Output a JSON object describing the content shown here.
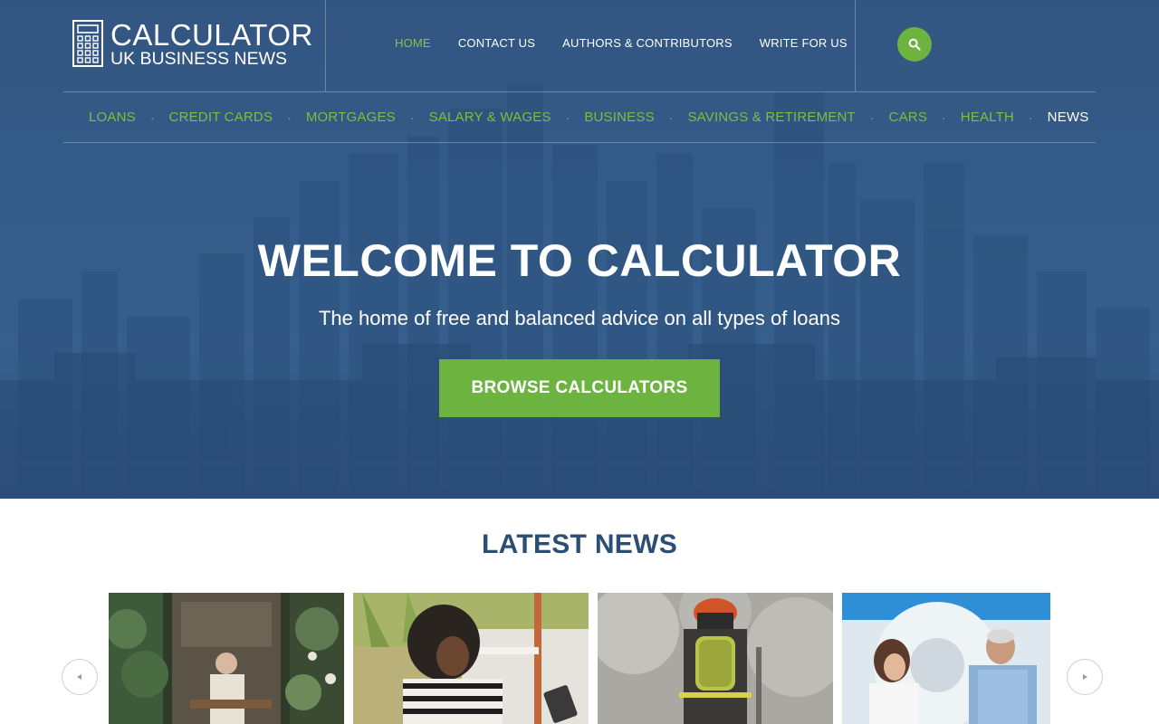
{
  "logo": {
    "title": "CALCULATOR",
    "subtitle": "UK BUSINESS NEWS",
    "icon": "calculator-icon"
  },
  "top_nav": [
    {
      "label": "HOME",
      "active": true
    },
    {
      "label": "CONTACT US",
      "active": false
    },
    {
      "label": "AUTHORS & CONTRIBUTORS",
      "active": false
    },
    {
      "label": "WRITE FOR US",
      "active": false
    }
  ],
  "search": {
    "icon": "search-icon"
  },
  "category_nav": [
    {
      "label": "LOANS"
    },
    {
      "label": "CREDIT CARDS"
    },
    {
      "label": "MORTGAGES"
    },
    {
      "label": "SALARY & WAGES"
    },
    {
      "label": "BUSINESS"
    },
    {
      "label": "SAVINGS & RETIREMENT"
    },
    {
      "label": "CARS"
    },
    {
      "label": "HEALTH"
    },
    {
      "label": "NEWS"
    }
  ],
  "category_separator": "·",
  "hero": {
    "title": "WELCOME TO CALCULATOR",
    "subtitle": "The home of free and balanced advice on all types of loans",
    "button_label": "BROWSE CALCULATORS"
  },
  "news": {
    "heading": "LATEST NEWS",
    "prev_icon": "caret-left-icon",
    "next_icon": "caret-right-icon",
    "cards": [
      {
        "image": "florist-shop-image"
      },
      {
        "image": "woman-with-tablet-image"
      },
      {
        "image": "firefighter-smoke-image"
      },
      {
        "image": "doctor-patient-mri-image"
      }
    ]
  },
  "colors": {
    "accent_green": "#6cb33f",
    "nav_green": "#7cbf3c",
    "heading_blue": "#2d4e74",
    "hero_blue": "#3b6593"
  }
}
